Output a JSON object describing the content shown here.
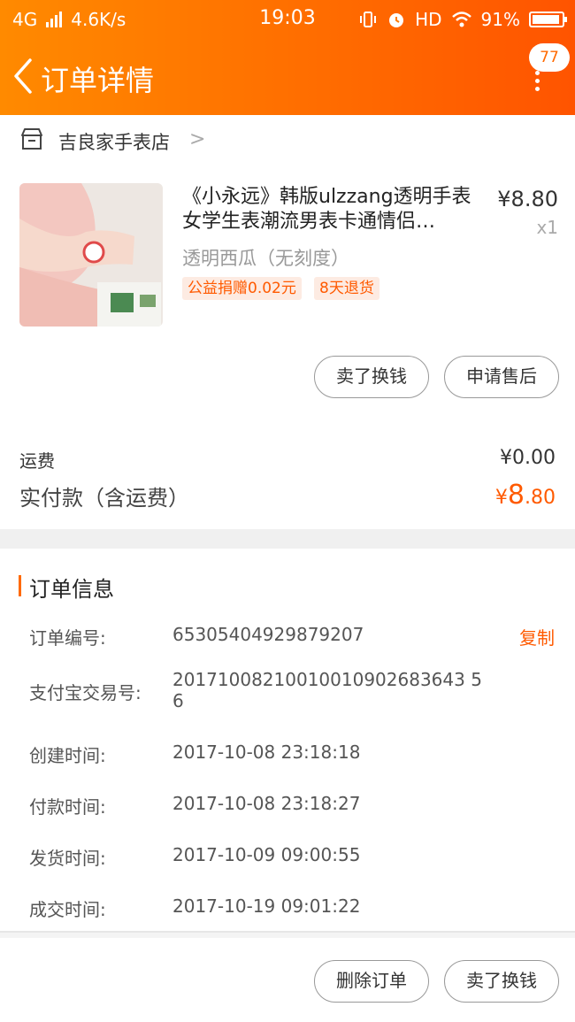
{
  "status_bar": {
    "network": "4G",
    "speed": "4.6K/s",
    "time": "19:03",
    "hd": "HD",
    "battery": "91%"
  },
  "nav": {
    "title": "订单详情",
    "badge_count": "77"
  },
  "shop": {
    "name": "吉良家手表店"
  },
  "product": {
    "title": "《小永远》韩版ulzzang透明手表女学生表潮流男表卡通情侣…",
    "price": "¥8.80",
    "quantity": "x1",
    "sku": "透明西瓜（无刻度）",
    "tags": [
      "公益捐赠0.02元",
      "8天退货"
    ],
    "actions": [
      "卖了换钱",
      "申请售后"
    ]
  },
  "summary": {
    "shipping_label": "运费",
    "shipping_value": "¥0.00",
    "paid_label": "实付款（含运费）",
    "paid_currency": "¥",
    "paid_int": "8",
    "paid_dec": ".80"
  },
  "order_info": {
    "title": "订单信息",
    "copy_label": "复制",
    "rows": [
      {
        "label": "订单编号:",
        "value": "65305404929879207"
      },
      {
        "label": "支付宝交易号:",
        "value": "20171008210010010902683643 56"
      },
      {
        "label": "创建时间:",
        "value": "2017-10-08 23:18:18"
      },
      {
        "label": "付款时间:",
        "value": "2017-10-08 23:18:27"
      },
      {
        "label": "发货时间:",
        "value": "2017-10-09 09:00:55"
      },
      {
        "label": "成交时间:",
        "value": "2017-10-19 09:01:22"
      }
    ]
  },
  "bottom_actions": {
    "delete": "删除订单",
    "resell": "卖了换钱"
  },
  "colors": {
    "accent": "#ff6a00",
    "header_start": "#ff8a00",
    "header_end": "#ff5400"
  }
}
